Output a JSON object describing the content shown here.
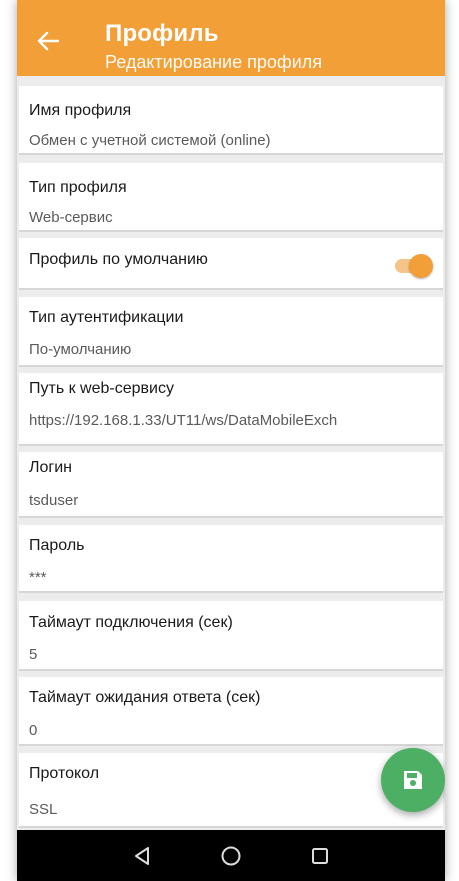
{
  "header": {
    "title": "Профиль",
    "subtitle": "Редактирование профиля",
    "color": "#f29f37"
  },
  "fields": [
    {
      "label": "Имя профиля",
      "value": "Обмен с учетной системой (online)"
    },
    {
      "label": "Тип профиля",
      "value": "Web-сервис"
    },
    {
      "label": "Профиль по умолчанию",
      "toggle_on": true
    },
    {
      "label": "Тип аутентификации",
      "value": "По-умолчанию"
    },
    {
      "label": "Путь к web-сервису",
      "value": "https://192.168.1.33/UT11/ws/DataMobileExch"
    },
    {
      "label": "Логин",
      "value": "tsduser"
    },
    {
      "label": "Пароль",
      "value": "***"
    },
    {
      "label": "Таймаут подключения (сек)",
      "value": "5"
    },
    {
      "label": "Таймаут ожидания ответа (сек)",
      "value": "0"
    },
    {
      "label": "Протокол",
      "value": "SSL"
    }
  ],
  "fab": {
    "icon": "save-icon",
    "color": "#4caf63"
  },
  "navbar": {
    "icons": [
      "back-triangle-icon",
      "home-circle-icon",
      "recents-square-icon"
    ]
  }
}
